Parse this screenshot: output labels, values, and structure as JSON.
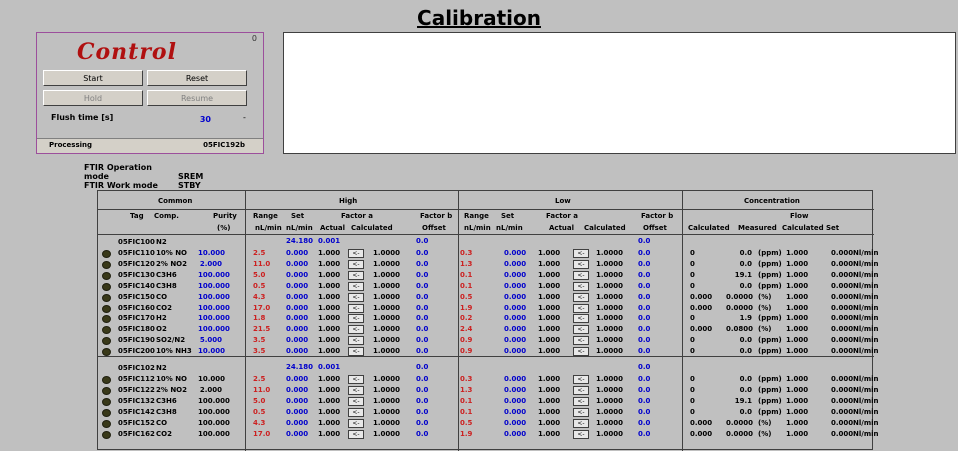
{
  "title": "Calibration",
  "control": {
    "heading": "Control",
    "close_glyph": "0",
    "buttons": {
      "start": "Start",
      "reset": "Reset",
      "hold": "Hold",
      "resume": "Resume"
    },
    "flush_label": "Flush time [s]",
    "flush_value": "30",
    "flush_dash": "-",
    "status": "Processing",
    "status_code": "05FIC192b"
  },
  "ftir": {
    "operation_label": "FTIR Operation mode",
    "operation_value": "SREM",
    "work_label": "FTIR Work mode",
    "work_value": "STBY"
  },
  "table": {
    "groups": {
      "common": "Common",
      "high": "High",
      "low": "Low",
      "concentration": "Concentration"
    },
    "subheaders": {
      "tag": "Tag",
      "comp": "Comp.",
      "purity": "Purity",
      "purity_unit": "(%)",
      "range": "Range",
      "set": "Set",
      "factor_a": "Factor a",
      "factor_b": "Factor b",
      "unit_nlmin": "nL/min",
      "actual": "Actual",
      "calculated": "Calculated",
      "offset": "Offset",
      "flow": "Flow",
      "measured": "Measured",
      "set_conc": "Set"
    },
    "arrow_glyph": "<-",
    "group1": {
      "tag": "05FIC100",
      "comp": "N2",
      "high_set": "24.180",
      "high_actual": "0.001",
      "high_offset": "0.0",
      "low_offset": "0.0"
    },
    "rows1": [
      {
        "tag": "05FIC110",
        "comp": "10% NO",
        "purity": "10.000",
        "h_range": "2.5",
        "h_set": "0.000",
        "h_act": "1.000",
        "h_calc": "1.0000",
        "h_off": "0.0",
        "l_range": "0.3",
        "l_set": "0.000",
        "l_act": "1.000",
        "l_calc": "1.0000",
        "l_off": "0.0",
        "c_calc": "0",
        "c_meas": "0.0",
        "c_unit": "(ppm)",
        "f_calc": "1.000",
        "f_set": "0.000",
        "f_unit": "Nl/min"
      },
      {
        "tag": "05FIC120",
        "comp": "2% NO2",
        "purity": "2.000",
        "h_range": "11.0",
        "h_set": "0.000",
        "h_act": "1.000",
        "h_calc": "1.0000",
        "h_off": "0.0",
        "l_range": "1.3",
        "l_set": "0.000",
        "l_act": "1.000",
        "l_calc": "1.0000",
        "l_off": "0.0",
        "c_calc": "0",
        "c_meas": "0.0",
        "c_unit": "(ppm)",
        "f_calc": "1.000",
        "f_set": "0.000",
        "f_unit": "Nl/min"
      },
      {
        "tag": "05FIC130",
        "comp": "C3H6",
        "purity": "100.000",
        "h_range": "5.0",
        "h_set": "0.000",
        "h_act": "1.000",
        "h_calc": "1.0000",
        "h_off": "0.0",
        "l_range": "0.1",
        "l_set": "0.000",
        "l_act": "1.000",
        "l_calc": "1.0000",
        "l_off": "0.0",
        "c_calc": "0",
        "c_meas": "19.1",
        "c_unit": "(ppm)",
        "f_calc": "1.000",
        "f_set": "0.000",
        "f_unit": "Nl/min"
      },
      {
        "tag": "05FIC140",
        "comp": "C3H8",
        "purity": "100.000",
        "h_range": "0.5",
        "h_set": "0.000",
        "h_act": "1.000",
        "h_calc": "1.0000",
        "h_off": "0.0",
        "l_range": "0.1",
        "l_set": "0.000",
        "l_act": "1.000",
        "l_calc": "1.0000",
        "l_off": "0.0",
        "c_calc": "0",
        "c_meas": "0.0",
        "c_unit": "(ppm)",
        "f_calc": "1.000",
        "f_set": "0.000",
        "f_unit": "Nl/min"
      },
      {
        "tag": "05FIC150",
        "comp": "CO",
        "purity": "100.000",
        "h_range": "4.3",
        "h_set": "0.000",
        "h_act": "1.000",
        "h_calc": "1.0000",
        "h_off": "0.0",
        "l_range": "0.5",
        "l_set": "0.000",
        "l_act": "1.000",
        "l_calc": "1.0000",
        "l_off": "0.0",
        "c_calc": "0.000",
        "c_meas": "0.0000",
        "c_unit": "(%)",
        "f_calc": "1.000",
        "f_set": "0.000",
        "f_unit": "Nl/min"
      },
      {
        "tag": "05FIC160",
        "comp": "CO2",
        "purity": "100.000",
        "h_range": "17.0",
        "h_set": "0.000",
        "h_act": "1.000",
        "h_calc": "1.0000",
        "h_off": "0.0",
        "l_range": "1.9",
        "l_set": "0.000",
        "l_act": "1.000",
        "l_calc": "1.0000",
        "l_off": "0.0",
        "c_calc": "0.000",
        "c_meas": "0.0000",
        "c_unit": "(%)",
        "f_calc": "1.000",
        "f_set": "0.000",
        "f_unit": "Nl/min"
      },
      {
        "tag": "05FIC170",
        "comp": "H2",
        "purity": "100.000",
        "h_range": "1.8",
        "h_set": "0.000",
        "h_act": "1.000",
        "h_calc": "1.0000",
        "h_off": "0.0",
        "l_range": "0.2",
        "l_set": "0.000",
        "l_act": "1.000",
        "l_calc": "1.0000",
        "l_off": "0.0",
        "c_calc": "0",
        "c_meas": "1.9",
        "c_unit": "(ppm)",
        "f_calc": "1.000",
        "f_set": "0.000",
        "f_unit": "Nl/min"
      },
      {
        "tag": "05FIC180",
        "comp": "O2",
        "purity": "100.000",
        "h_range": "21.5",
        "h_set": "0.000",
        "h_act": "1.000",
        "h_calc": "1.0000",
        "h_off": "0.0",
        "l_range": "2.4",
        "l_set": "0.000",
        "l_act": "1.000",
        "l_calc": "1.0000",
        "l_off": "0.0",
        "c_calc": "0.000",
        "c_meas": "0.0800",
        "c_unit": "(%)",
        "f_calc": "1.000",
        "f_set": "0.000",
        "f_unit": "Nl/min"
      },
      {
        "tag": "05FIC190",
        "comp": "SO2/N2",
        "purity": "5.000",
        "h_range": "3.5",
        "h_set": "0.000",
        "h_act": "1.000",
        "h_calc": "1.0000",
        "h_off": "0.0",
        "l_range": "0.9",
        "l_set": "0.000",
        "l_act": "1.000",
        "l_calc": "1.0000",
        "l_off": "0.0",
        "c_calc": "0",
        "c_meas": "0.0",
        "c_unit": "(ppm)",
        "f_calc": "1.000",
        "f_set": "0.000",
        "f_unit": "Nl/min"
      },
      {
        "tag": "05FIC200",
        "comp": "10% NH3",
        "purity": "10.000",
        "h_range": "3.5",
        "h_set": "0.000",
        "h_act": "1.000",
        "h_calc": "1.0000",
        "h_off": "0.0",
        "l_range": "0.9",
        "l_set": "0.000",
        "l_act": "1.000",
        "l_calc": "1.0000",
        "l_off": "0.0",
        "c_calc": "0",
        "c_meas": "0.0",
        "c_unit": "(ppm)",
        "f_calc": "1.000",
        "f_set": "0.000",
        "f_unit": "Nl/min"
      }
    ],
    "group2": {
      "tag": "05FIC102",
      "comp": "N2",
      "high_set": "24.180",
      "high_actual": "0.001",
      "high_offset": "0.0",
      "low_offset": "0.0"
    },
    "rows2": [
      {
        "tag": "05FIC112",
        "comp": "10% NO",
        "purity": "10.000",
        "h_range": "2.5",
        "h_set": "0.000",
        "h_act": "1.000",
        "h_calc": "1.0000",
        "h_off": "0.0",
        "l_range": "0.3",
        "l_set": "0.000",
        "l_act": "1.000",
        "l_calc": "1.0000",
        "l_off": "0.0",
        "c_calc": "0",
        "c_meas": "0.0",
        "c_unit": "(ppm)",
        "f_calc": "1.000",
        "f_set": "0.000",
        "f_unit": "Nl/min"
      },
      {
        "tag": "05FIC122",
        "comp": "2% NO2",
        "purity": "2.000",
        "h_range": "11.0",
        "h_set": "0.000",
        "h_act": "1.000",
        "h_calc": "1.0000",
        "h_off": "0.0",
        "l_range": "1.3",
        "l_set": "0.000",
        "l_act": "1.000",
        "l_calc": "1.0000",
        "l_off": "0.0",
        "c_calc": "0",
        "c_meas": "0.0",
        "c_unit": "(ppm)",
        "f_calc": "1.000",
        "f_set": "0.000",
        "f_unit": "Nl/min"
      },
      {
        "tag": "05FIC132",
        "comp": "C3H6",
        "purity": "100.000",
        "h_range": "5.0",
        "h_set": "0.000",
        "h_act": "1.000",
        "h_calc": "1.0000",
        "h_off": "0.0",
        "l_range": "0.1",
        "l_set": "0.000",
        "l_act": "1.000",
        "l_calc": "1.0000",
        "l_off": "0.0",
        "c_calc": "0",
        "c_meas": "19.1",
        "c_unit": "(ppm)",
        "f_calc": "1.000",
        "f_set": "0.000",
        "f_unit": "Nl/min"
      },
      {
        "tag": "05FIC142",
        "comp": "C3H8",
        "purity": "100.000",
        "h_range": "0.5",
        "h_set": "0.000",
        "h_act": "1.000",
        "h_calc": "1.0000",
        "h_off": "0.0",
        "l_range": "0.1",
        "l_set": "0.000",
        "l_act": "1.000",
        "l_calc": "1.0000",
        "l_off": "0.0",
        "c_calc": "0",
        "c_meas": "0.0",
        "c_unit": "(ppm)",
        "f_calc": "1.000",
        "f_set": "0.000",
        "f_unit": "Nl/min"
      },
      {
        "tag": "05FIC152",
        "comp": "CO",
        "purity": "100.000",
        "h_range": "4.3",
        "h_set": "0.000",
        "h_act": "1.000",
        "h_calc": "1.0000",
        "h_off": "0.0",
        "l_range": "0.5",
        "l_set": "0.000",
        "l_act": "1.000",
        "l_calc": "1.0000",
        "l_off": "0.0",
        "c_calc": "0.000",
        "c_meas": "0.0000",
        "c_unit": "(%)",
        "f_calc": "1.000",
        "f_set": "0.000",
        "f_unit": "Nl/min"
      },
      {
        "tag": "05FIC162",
        "comp": "CO2",
        "purity": "100.000",
        "h_range": "17.0",
        "h_set": "0.000",
        "h_act": "1.000",
        "h_calc": "1.0000",
        "h_off": "0.0",
        "l_range": "1.9",
        "l_set": "0.000",
        "l_act": "1.000",
        "l_calc": "1.0000",
        "l_off": "0.0",
        "c_calc": "0.000",
        "c_meas": "0.0000",
        "c_unit": "(%)",
        "f_calc": "1.000",
        "f_set": "0.000",
        "f_unit": "Nl/min"
      }
    ]
  }
}
